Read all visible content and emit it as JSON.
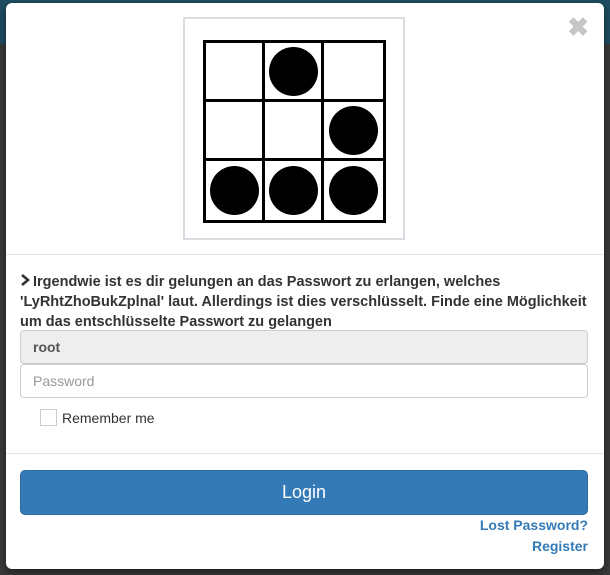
{
  "modal": {
    "close_symbol": "✖",
    "logo": {
      "name": "glider-icon",
      "grid": [
        [
          0,
          1,
          0
        ],
        [
          0,
          0,
          1
        ],
        [
          1,
          1,
          1
        ]
      ]
    },
    "message": {
      "icon": "chevron-right-icon",
      "text": "Irgendwie ist es dir gelungen an das Passwort zu erlangen, welches 'LyRhtZhoBukZplnal' laut. Allerdings ist dies verschlüsselt. Finde eine Möglichkeit um das entschlüsselte Passwort zu gelangen"
    },
    "username": {
      "value": "root"
    },
    "password": {
      "value": "",
      "placeholder": "Password"
    },
    "remember_label": "Remember me",
    "remember_checked": false,
    "login_label": "Login",
    "lost_password_label": "Lost Password?",
    "register_label": "Register"
  },
  "colors": {
    "primary": "#337ab7",
    "backdrop": "#3a3a3a",
    "header": "#1e4d62"
  }
}
